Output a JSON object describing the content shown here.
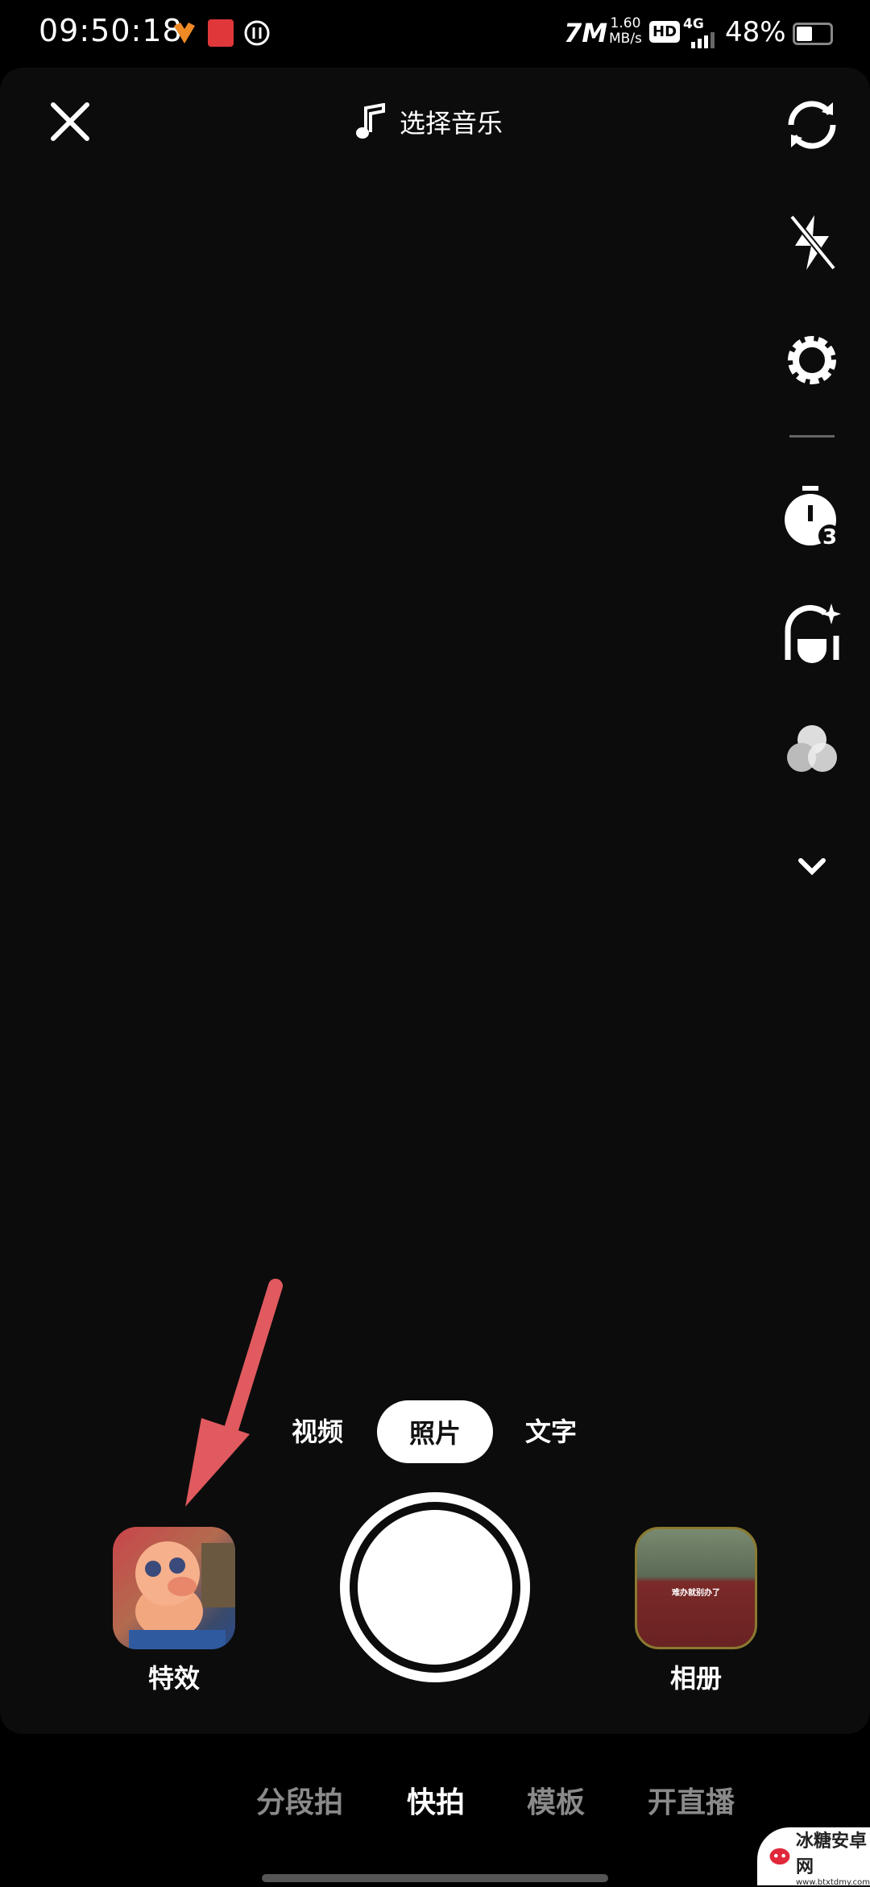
{
  "status_bar": {
    "time": "09:50:18",
    "speed_value": "1.60",
    "speed_unit": "MB/s",
    "hd": "HD",
    "network": "4G",
    "battery": "48%",
    "battery_level": 48
  },
  "top": {
    "music_label": "选择音乐"
  },
  "right_tools": [
    "flip-camera",
    "flash-off",
    "settings",
    "timer-3",
    "beauty",
    "filters",
    "expand-more"
  ],
  "timer_value": "3",
  "modes": {
    "video": "视频",
    "photo": "照片",
    "text": "文字",
    "selected": "照片"
  },
  "effects": {
    "label": "特效"
  },
  "album": {
    "label": "相册",
    "thumb_title": "难办就别办了"
  },
  "bottom_tabs": [
    {
      "label": "分段拍"
    },
    {
      "label": "快拍",
      "active": true
    },
    {
      "label": "模板"
    },
    {
      "label": "开直播"
    }
  ],
  "annotation": {
    "arrow_color": "#e05a5f"
  },
  "watermark": {
    "text": "冰糖安卓网",
    "url_text": "www.btxtdmy.com"
  }
}
